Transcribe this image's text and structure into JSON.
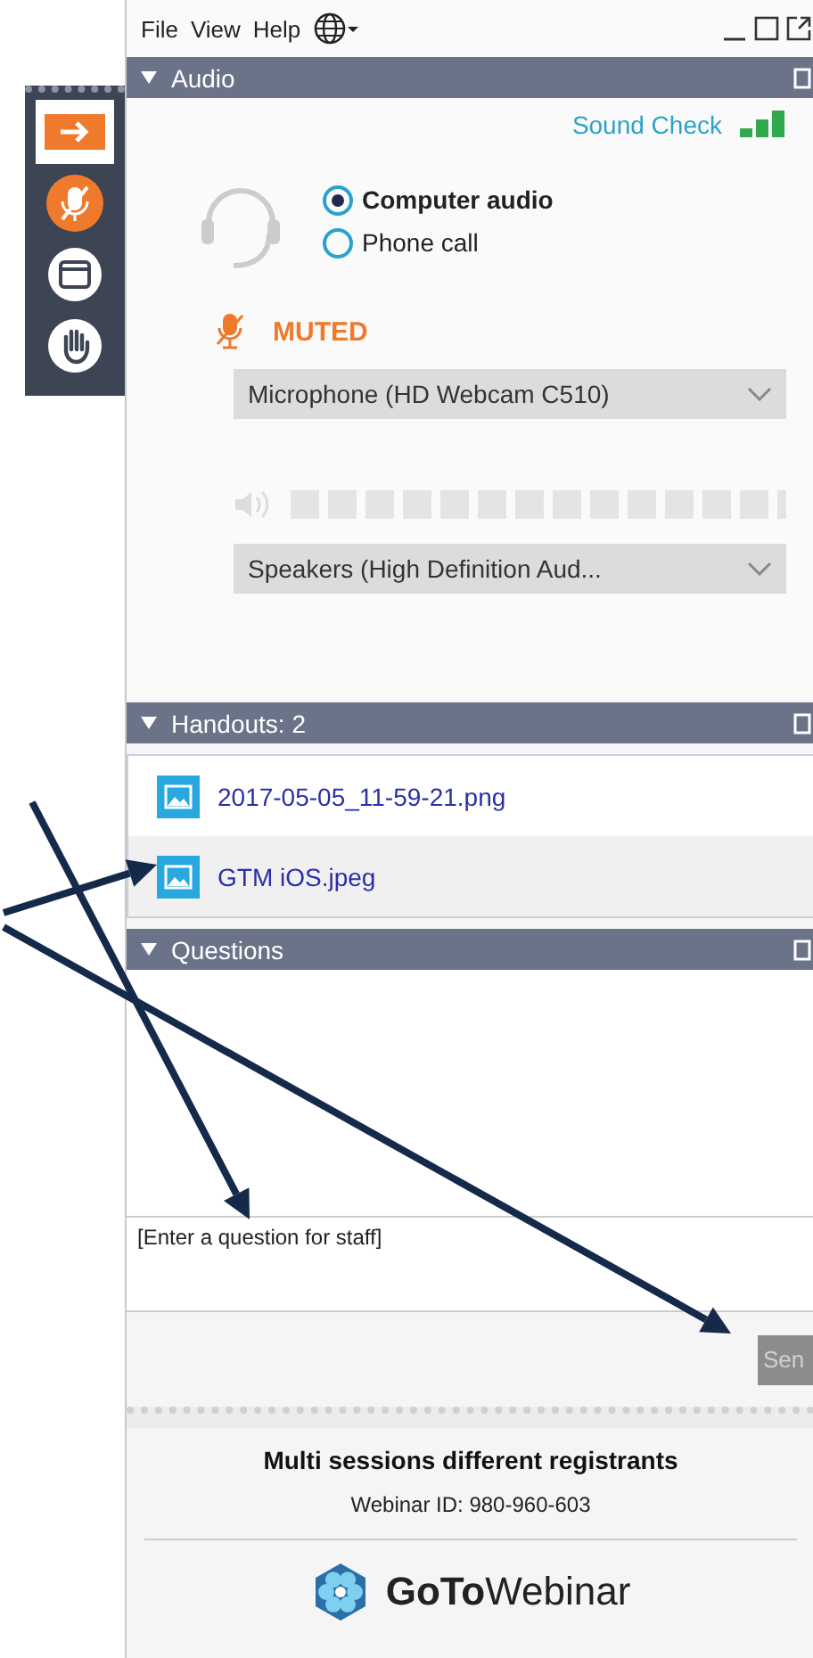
{
  "menu": [
    "File",
    "View",
    "Help"
  ],
  "audio": {
    "title": "Audio",
    "sound_check": "Sound Check",
    "options": [
      {
        "label": "Computer audio",
        "selected": true
      },
      {
        "label": "Phone call",
        "selected": false
      }
    ],
    "mute_status": "MUTED",
    "microphone": "Microphone (HD Webcam C510)",
    "speaker_meter": {
      "level": 0
    },
    "speakers": "Speakers (High Definition Aud..."
  },
  "handouts": {
    "title": "Handouts: 2",
    "items": [
      {
        "name": "2017-05-05_11-59-21.png",
        "selected": false
      },
      {
        "name": "GTM iOS.jpeg",
        "selected": true
      }
    ]
  },
  "questions": {
    "title": "Questions",
    "placeholder": "[Enter a question for staff]",
    "send": "Sen"
  },
  "footer": {
    "title": "Multi sessions different registrants",
    "webinar_id": "Webinar ID: 980-960-603",
    "logo": "**GoTo**Webinar"
  }
}
